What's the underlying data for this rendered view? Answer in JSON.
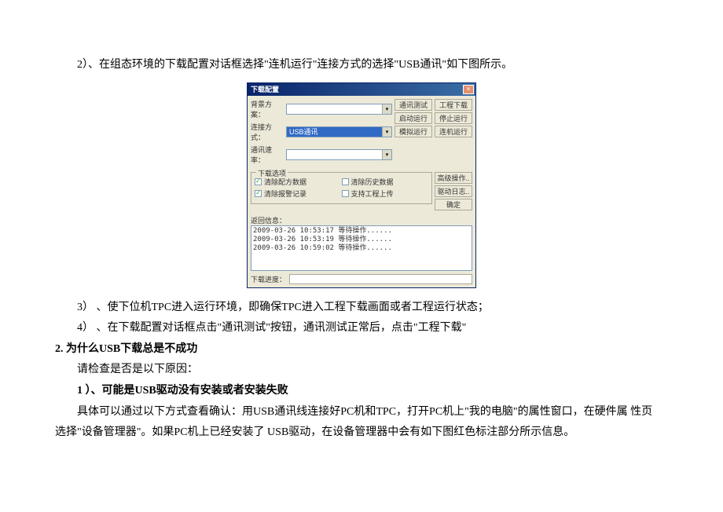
{
  "doc": {
    "p1": "2）、在组态环境的下载配置对话框选择\"连机运行\"连接方式的选择\"USB通讯\"如下图所示。",
    "p2": "3） 、使下位机TPC进入运行环境，即确保TPC进入工程下载画面或者工程运行状态；",
    "p3": "4） 、在下载配置对话框点击\"通讯测试\"按钮，通讯测试正常后，点击\"工程下载\"",
    "h2": "2.  为什么USB下载总是不成功",
    "p4": "请检查是否是以下原因：",
    "h3": "1 ）、可能是USB驱动没有安装或者安装失败",
    "p5": "具体可以通过以下方式查看确认：用USB通讯线连接好PC机和TPC，打开PC机上\"我的电脑\"的属性窗口，在硬件属  性页",
    "p6": "选择\"设备管理器\"。如果PC机上已经安装了 USB驱动，在设备管理器中会有如下图红色标注部分所示信息。"
  },
  "dialog": {
    "title": "下载配置",
    "labels": {
      "bgScheme": "背景方案：",
      "connType": "连接方式：",
      "baud": "通讯速率：",
      "downloadOpts": "下载选项",
      "returnInfo": "返回信息：",
      "downloadProg": "下载进度："
    },
    "selects": {
      "bgScheme_value": "",
      "connType_value": "USB通讯",
      "baud_value": ""
    },
    "buttons": {
      "commTest": "通讯测试",
      "projDownload": "工程下载",
      "startSim": "启动运行",
      "stopRun": "停止运行",
      "simRun": "模拟运行",
      "onlineRun": "连机运行",
      "advanced": "高级操作..",
      "driverLog": "驱动日志..",
      "ok": "确定"
    },
    "checks": {
      "clearConfig": "清除配方数据",
      "clearHist": "清除历史数据",
      "clearAlarm": "清除报警记录",
      "supportUpload": "支持工程上传"
    },
    "log": [
      "2009-03-26 10:53:17   等待操作......",
      "2009-03-26 10:53:19   等待操作......",
      "2009-03-26 10:59:02   等待操作......"
    ]
  }
}
